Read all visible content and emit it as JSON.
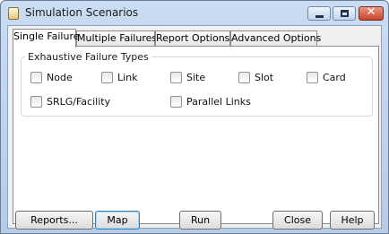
{
  "window": {
    "title": "Simulation Scenarios",
    "controls": {
      "minimize": "minimize",
      "maximize": "maximize",
      "close": "✕"
    }
  },
  "tabs": [
    {
      "label": "Single Failure",
      "active": true
    },
    {
      "label": "Multiple Failures",
      "active": false
    },
    {
      "label": "Report Options",
      "active": false
    },
    {
      "label": "Advanced Options",
      "active": false
    }
  ],
  "failure_types": {
    "group_title": "Exhaustive Failure Types",
    "options": [
      {
        "label": "Node",
        "checked": false
      },
      {
        "label": "Link",
        "checked": false
      },
      {
        "label": "Site",
        "checked": false
      },
      {
        "label": "Slot",
        "checked": false
      },
      {
        "label": "Card",
        "checked": false
      },
      {
        "label": "SRLG/Facility",
        "checked": false
      },
      {
        "label": "Parallel Links",
        "checked": false
      }
    ]
  },
  "buttons": {
    "reports": "Reports...",
    "map": "Map",
    "run": "Run",
    "close": "Close",
    "help": "Help"
  },
  "colors": {
    "titlebar": "#c9dcf2",
    "close_button": "#c8452b",
    "focus_border": "#3c7fb1"
  }
}
